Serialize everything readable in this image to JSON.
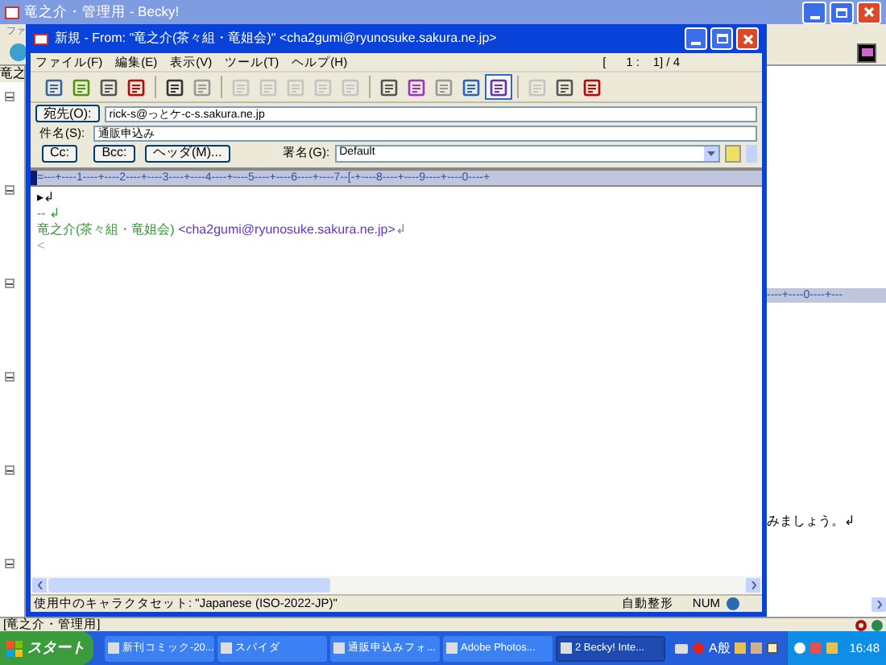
{
  "main_window": {
    "title": "竜之介・管理用 - Becky!",
    "menu_fragment": "ファ",
    "tree_header": "竜之",
    "tree_nodes": [
      {
        "expanded": true
      },
      {
        "expanded": true
      },
      {
        "expanded": true
      },
      {
        "expanded": true
      },
      {
        "expanded": true
      },
      {
        "expanded": true
      }
    ],
    "ruler_fragment": "----+----0----+---",
    "body_fragment": "みましょう。↲",
    "status": "[竜之介・管理用]"
  },
  "compose_window": {
    "title": "新規 - From: \"竜之介(茶々組・竜姐会)\" <cha2gumi@ryunosuke.sakura.ne.jp>",
    "menu": [
      "ファイル(F)",
      "編集(E)",
      "表示(V)",
      "ツール(T)",
      "ヘルプ(H)"
    ],
    "position": "[      1 :    1] / 4",
    "toolbar": [
      {
        "kind": "button",
        "disabled": false,
        "selected": false
      },
      {
        "kind": "button",
        "disabled": false,
        "selected": false
      },
      {
        "kind": "button",
        "disabled": false,
        "selected": false
      },
      {
        "kind": "button",
        "disabled": false,
        "selected": false
      },
      {
        "kind": "separator"
      },
      {
        "kind": "button",
        "disabled": false,
        "selected": false
      },
      {
        "kind": "button",
        "disabled": false,
        "selected": false
      },
      {
        "kind": "separator"
      },
      {
        "kind": "button",
        "disabled": true,
        "selected": false
      },
      {
        "kind": "button",
        "disabled": true,
        "selected": false
      },
      {
        "kind": "button",
        "disabled": true,
        "selected": false
      },
      {
        "kind": "button",
        "disabled": true,
        "selected": false
      },
      {
        "kind": "button",
        "disabled": true,
        "selected": false
      },
      {
        "kind": "separator"
      },
      {
        "kind": "button",
        "disabled": false,
        "selected": false
      },
      {
        "kind": "button",
        "disabled": false,
        "selected": false
      },
      {
        "kind": "button",
        "disabled": false,
        "selected": false
      },
      {
        "kind": "button",
        "disabled": false,
        "selected": false
      },
      {
        "kind": "button",
        "disabled": false,
        "selected": true
      },
      {
        "kind": "separator"
      },
      {
        "kind": "button",
        "disabled": true,
        "selected": false
      },
      {
        "kind": "button",
        "disabled": false,
        "selected": false
      },
      {
        "kind": "button",
        "disabled": false,
        "selected": false
      }
    ],
    "to_button": "宛先(O):",
    "to_value": "rick-s@っとケ-c-s.sakura.ne.jp",
    "subject_label": "件名(S):",
    "subject_value": "通販申込み",
    "cc_button": "Cc:",
    "bcc_button": "Bcc:",
    "header_button": "ヘッダ(M)...",
    "signature_label": "署名(G):",
    "signature_value": "Default",
    "ruler": "=---+----1----+----2----+----3----+----4----+----5----+----6----+----7--[-+----8----+----9----+----0----+",
    "body_lines": [
      {
        "segments": [
          {
            "text": "▸↲",
            "color": "#000000"
          }
        ]
      },
      {
        "segments": [
          {
            "text": "-- ↲",
            "color": "#339933"
          }
        ]
      },
      {
        "segments": [
          {
            "text": "竜之介(茶々組・竜姐会) ",
            "color": "#339933"
          },
          {
            "text": "<cha2gumi@ryunosuke.sakura.ne.jp>",
            "color": "#6633cc"
          },
          {
            "text": "↲",
            "color": "#888888"
          }
        ]
      },
      {
        "segments": [
          {
            "text": "<",
            "color": "#aaaaaa"
          }
        ]
      }
    ],
    "status_charset": "使用中のキャラクタセット: \"Japanese (ISO-2022-JP)\"",
    "status_format": "自動整形",
    "status_num": "NUM"
  },
  "taskbar": {
    "start": "スタート",
    "items": [
      {
        "label": "新刊コミック-20...",
        "selected": false
      },
      {
        "label": "スパイダ",
        "selected": false
      },
      {
        "label": "通販申込みフォ...",
        "selected": false
      },
      {
        "label": "Adobe Photos...",
        "selected": false
      },
      {
        "label": "2 Becky! Inte...",
        "selected": true
      }
    ],
    "ime": "A般",
    "clock": "16:48"
  }
}
